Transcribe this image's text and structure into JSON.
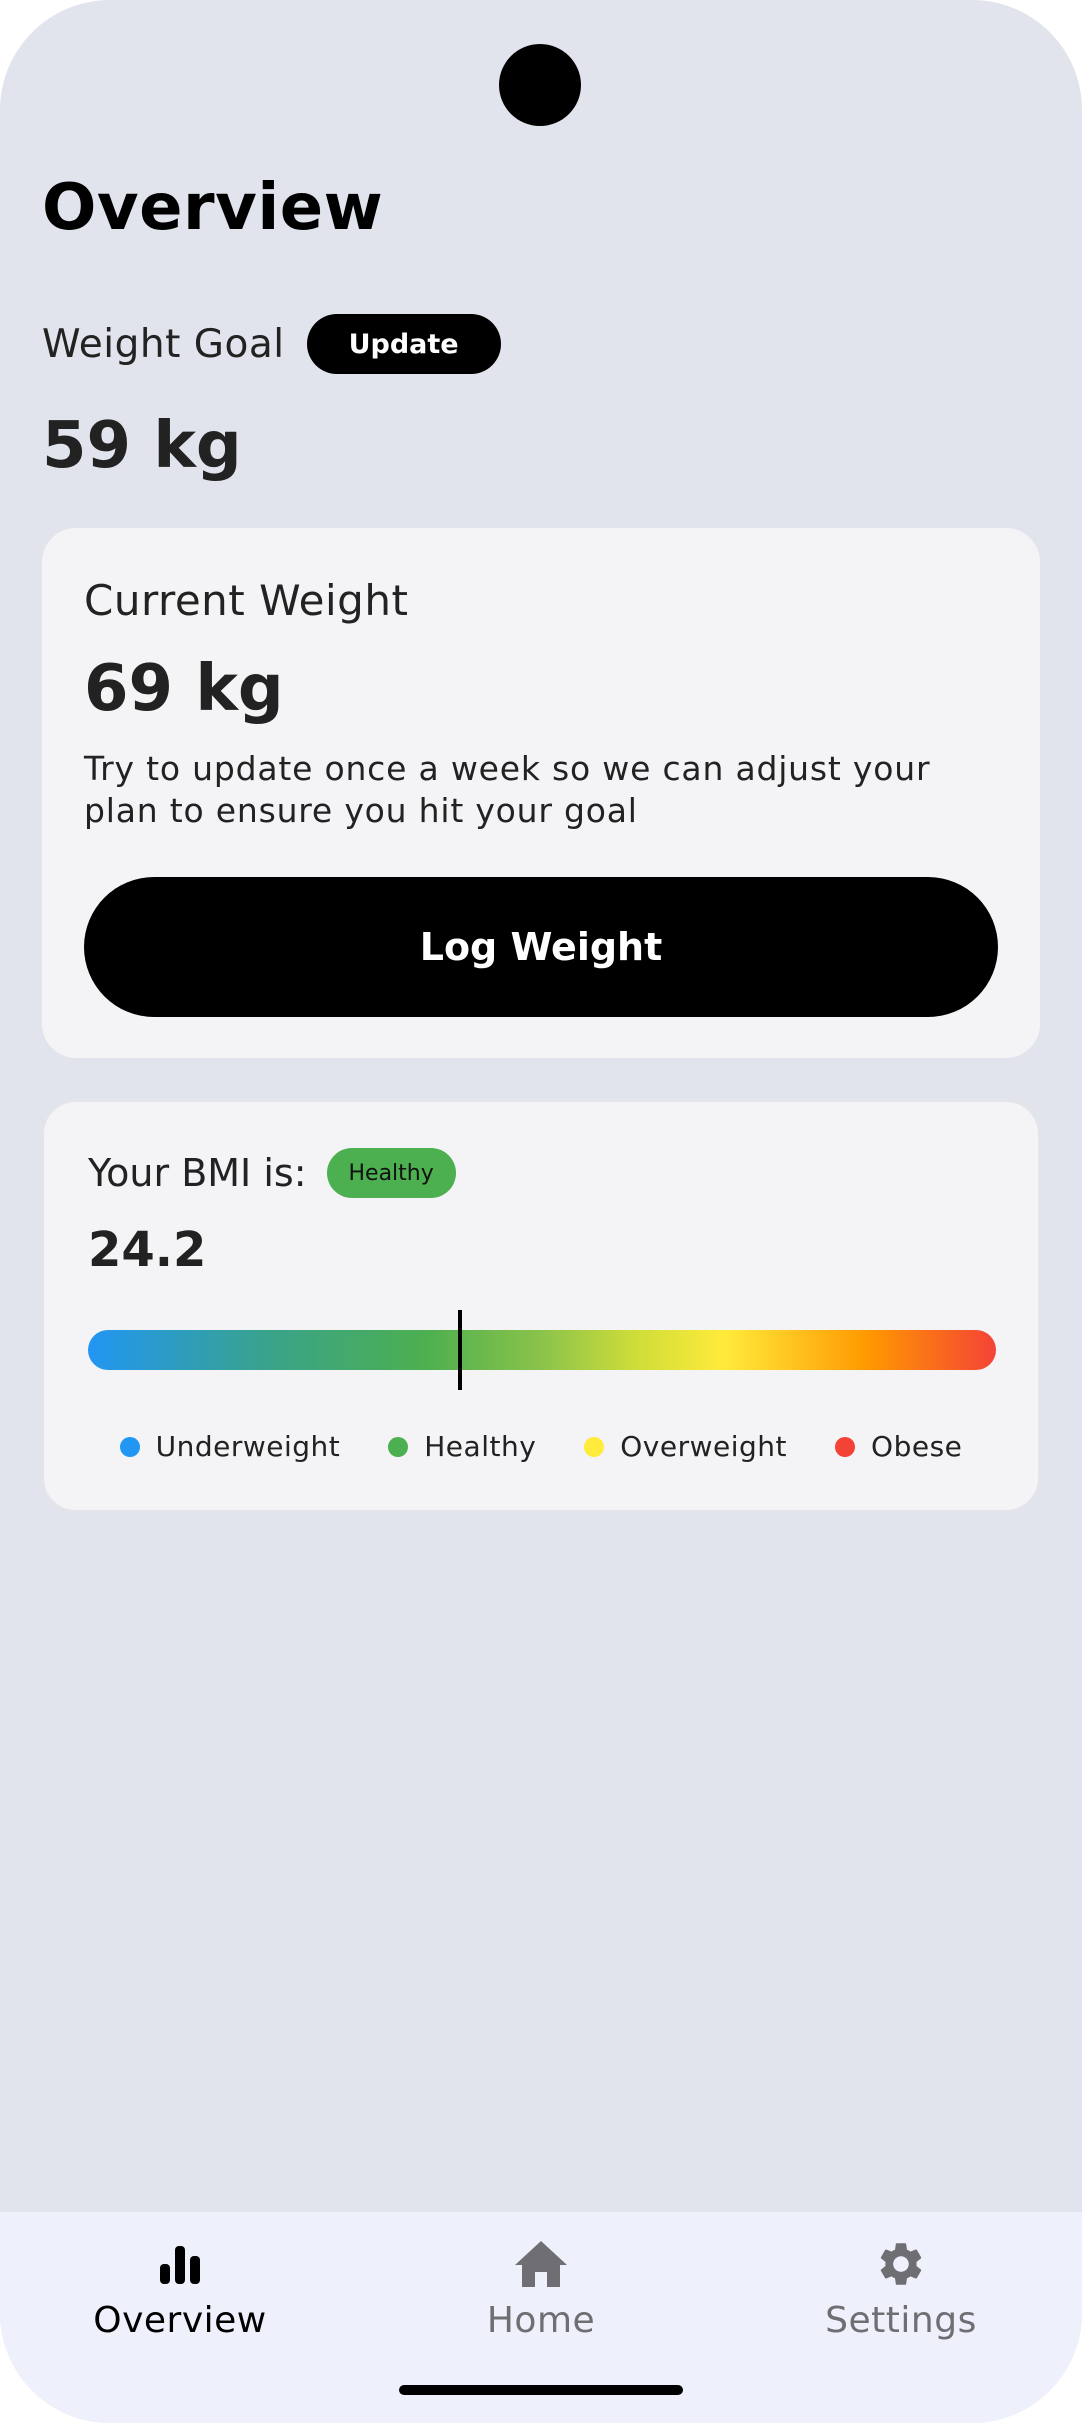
{
  "page": {
    "title": "Overview"
  },
  "goal": {
    "label": "Weight Goal",
    "update_label": "Update",
    "value": "59 kg"
  },
  "current_weight": {
    "label": "Current Weight",
    "value": "69 kg",
    "hint": "Try to update once a week so we can adjust your plan to ensure you hit your goal",
    "button_label": "Log Weight"
  },
  "bmi": {
    "label": "Your BMI is:",
    "status": "Healthy",
    "status_color": "#4caf50",
    "value": "24.2",
    "marker_fraction": 0.41,
    "legend": [
      {
        "label": "Underweight",
        "color": "#2196f3"
      },
      {
        "label": "Healthy",
        "color": "#4caf50"
      },
      {
        "label": "Overweight",
        "color": "#ffeb3b"
      },
      {
        "label": "Obese",
        "color": "#f44336"
      }
    ]
  },
  "nav": {
    "items": [
      {
        "label": "Overview",
        "icon": "bar-chart-icon",
        "active": true
      },
      {
        "label": "Home",
        "icon": "home-icon",
        "active": false
      },
      {
        "label": "Settings",
        "icon": "gear-icon",
        "active": false
      }
    ]
  }
}
